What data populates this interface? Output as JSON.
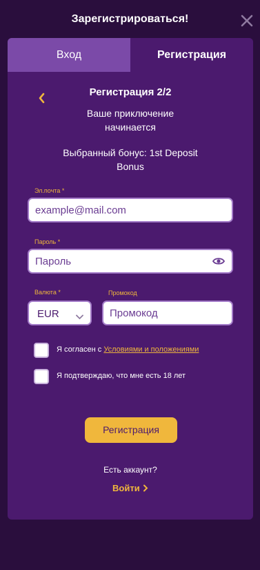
{
  "header": {
    "title": "Зарегистрироваться!",
    "close_icon": "close-icon"
  },
  "tabs": [
    {
      "label": "Вход",
      "active": false
    },
    {
      "label": "Регистрация",
      "active": true
    }
  ],
  "form": {
    "step_title": "Регистрация 2/2",
    "subtitle": "Ваше приключение начинается",
    "bonus_text": "Выбранный бонус: 1st Deposit Bonus",
    "email": {
      "label": "Эл.почта *",
      "placeholder": "example@mail.com",
      "value": ""
    },
    "password": {
      "label": "Пароль *",
      "placeholder": "Пароль",
      "value": "",
      "icon": "eye-icon"
    },
    "currency": {
      "label": "Валюта *",
      "value": "EUR"
    },
    "promo": {
      "label": "Промокод",
      "placeholder": "Промокод",
      "value": ""
    },
    "terms": {
      "prefix": "Я согласен с ",
      "link": "Условиями и положениями",
      "checked": false
    },
    "age": {
      "text": "Я подтверждаю, что мне есть 18 лет",
      "checked": false
    },
    "submit_label": "Регистрация",
    "have_account": "Есть аккаунт?",
    "login_label": "Войти"
  },
  "colors": {
    "background": "#2a0e3d",
    "card": "#4b1a6e",
    "active_tab": "#7b4aa8",
    "accent": "#f0b73c",
    "input_border": "#a37bc8"
  }
}
